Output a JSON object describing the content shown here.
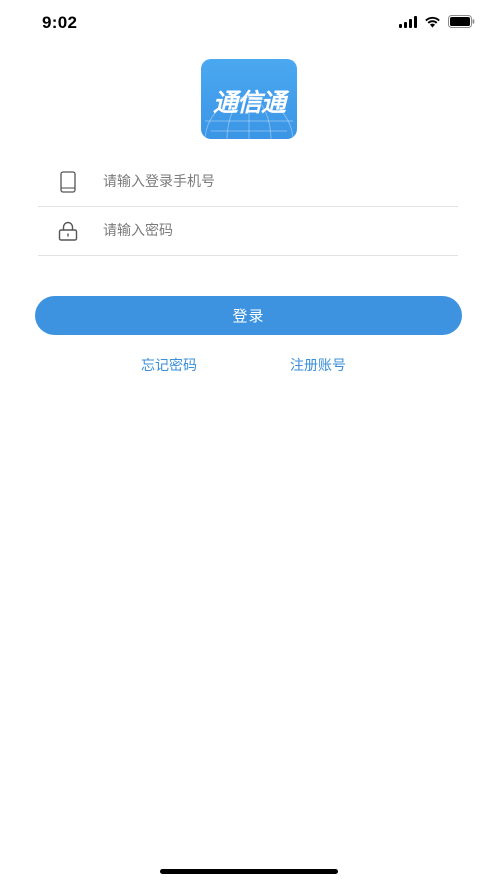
{
  "status_bar": {
    "time": "9:02",
    "icons": [
      "signal-icon",
      "wifi-icon",
      "battery-icon"
    ]
  },
  "logo": {
    "text": "通信通",
    "color": "#3d97e8"
  },
  "form": {
    "phone_placeholder": "请输入登录手机号",
    "phone_value": "",
    "phone_icon": "phone-icon",
    "password_placeholder": "请输入密码",
    "password_value": "",
    "password_icon": "lock-icon"
  },
  "login_button": {
    "label": "登录",
    "color": "#3d93e0"
  },
  "links": {
    "forgot_password": "忘记密码",
    "register": "注册账号",
    "color": "#3a8fd8"
  }
}
